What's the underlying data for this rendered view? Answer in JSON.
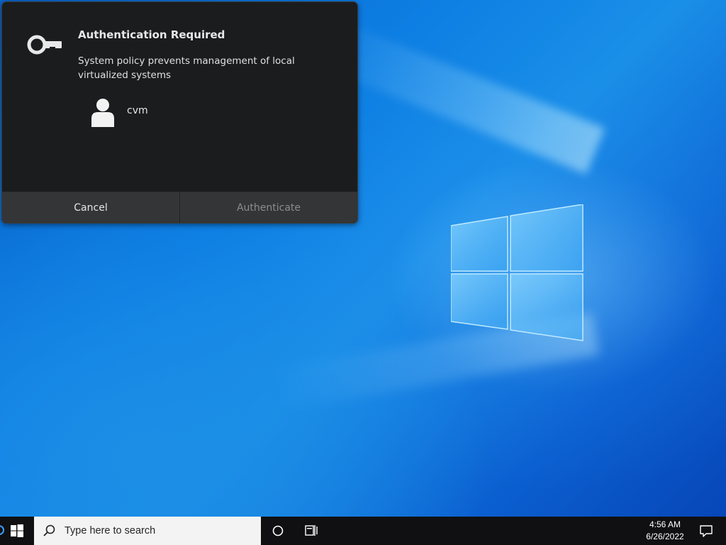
{
  "dialog": {
    "title": "Authentication Required",
    "message": "System policy prevents management of local virtualized systems",
    "user": "cvm",
    "cancel_label": "Cancel",
    "authenticate_label": "Authenticate",
    "icons": {
      "key": "key-icon",
      "user": "user-avatar-icon"
    }
  },
  "taskbar": {
    "search_placeholder": "Type here to search",
    "time": "4:56 AM",
    "date": "6/26/2022",
    "icons": [
      "windows-start-icon",
      "search-icon",
      "cortana-icon",
      "task-view-icon",
      "notification-icon"
    ]
  },
  "colors": {
    "dialog_bg": "#1b1c1e",
    "button_bg": "#343537",
    "taskbar_bg": "#101012",
    "desktop_accent": "#0d7ee3"
  }
}
